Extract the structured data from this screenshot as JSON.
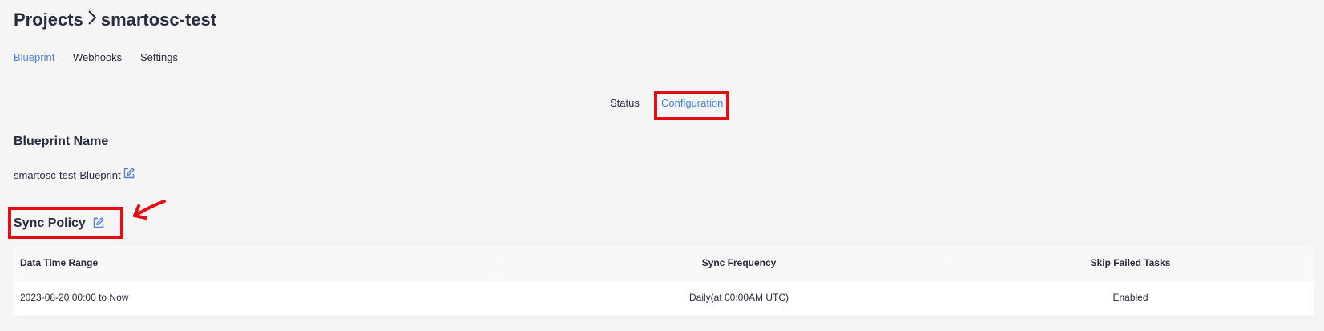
{
  "breadcrumb": {
    "root": "Projects",
    "separator": ">",
    "current": "smartosc-test"
  },
  "tabs": [
    "Blueprint",
    "Webhooks",
    "Settings"
  ],
  "subtabs": [
    "Status",
    "Configuration"
  ],
  "blueprint_name": {
    "heading": "Blueprint Name",
    "value": "smartosc-test-Blueprint"
  },
  "sync_policy": {
    "heading": "Sync Policy",
    "columns": [
      "Data Time Range",
      "Sync Frequency",
      "Skip Failed Tasks"
    ],
    "row": [
      "2023-08-20 00:00 to Now",
      "Daily(at 00:00AM UTC)",
      "Enabled"
    ]
  },
  "colors": {
    "accent": "#4f7fde",
    "highlight": "#e60d12",
    "text": "#292b3f"
  }
}
